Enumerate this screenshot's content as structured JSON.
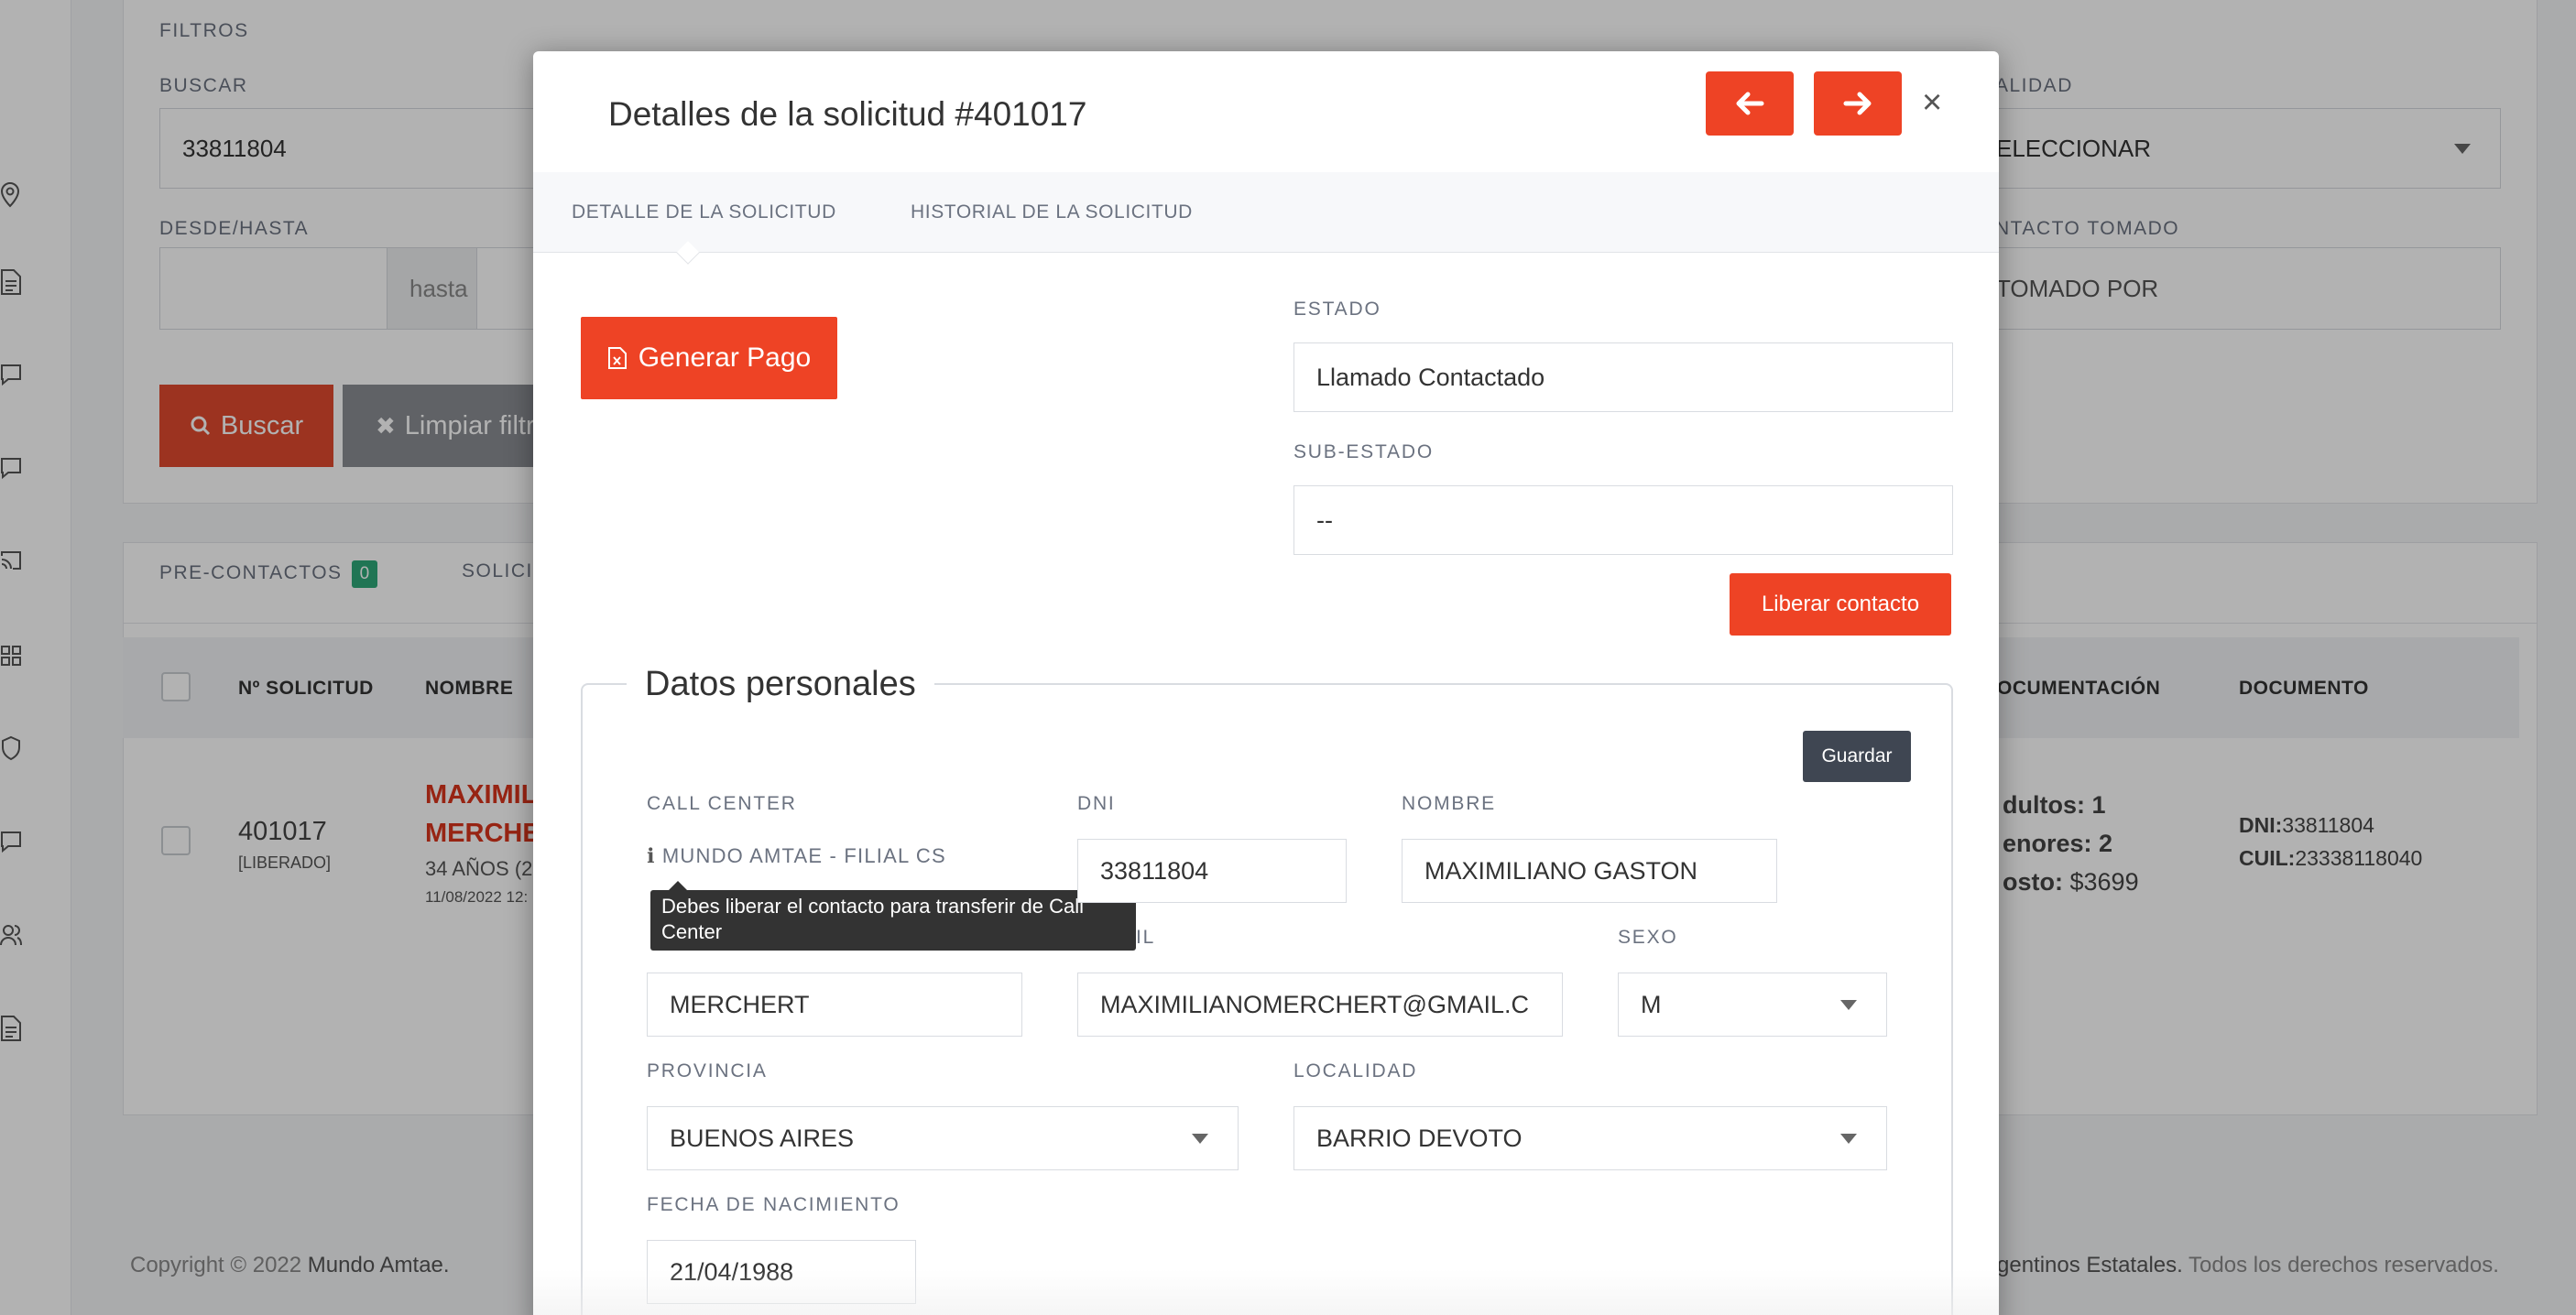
{
  "background": {
    "filters": {
      "section_title": "FILTROS",
      "buscar_label": "BUSCAR",
      "buscar_value": "33811804",
      "desde_hasta_label": "DESDE/HASTA",
      "hasta_text": "hasta",
      "localidad_label_partial": "ALIDAD",
      "localidad_value_partial": "ELECCIONAR",
      "contacto_label_partial": "NTACTO TOMADO",
      "contacto_placeholder_partial": "TOMADO POR",
      "buscar_button": "Buscar",
      "limpiar_button_partial": "Limpiar filtro"
    },
    "tabs": {
      "precontactos_label": "PRE-CONTACTOS",
      "precontactos_count": "0",
      "solicitudes_partial": "SOLICI"
    },
    "table": {
      "headers": {
        "numero": "Nº SOLICITUD",
        "nombre": "NOMBRE",
        "documentacion_partial": "OCUMENTACIÓN",
        "documento": "DOCUMENTO"
      },
      "row": {
        "numero": "401017",
        "estado": "[LIBERADO]",
        "nombre_line1_partial": "MAXIMIL",
        "nombre_line2_partial": "MERCHE",
        "edad_partial": "34 AÑOS (2",
        "fecha_partial": "11/08/2022 12:",
        "adultos_partial": "dultos: 1",
        "menores_partial": "enores: 2",
        "costo_label_partial": "osto:",
        "costo_value": "$3699",
        "dni_label": "DNI:",
        "dni_value": "33811804",
        "cuil_label": "CUIL:",
        "cuil_value": "23338118040"
      }
    },
    "footer": {
      "copyright": "Copyright © 2022",
      "brand": "Mundo Amtae.",
      "right_partial_1": "gentinos Estatales.",
      "right_partial_2": "Todos los derechos reservados."
    }
  },
  "modal": {
    "title": "Detalles de la solicitud #401017",
    "close_symbol": "×",
    "tabs": [
      "DETALLE DE LA SOLICITUD",
      "HISTORIAL DE LA SOLICITUD"
    ],
    "generar_pago_label": "Generar Pago",
    "estado_label": "ESTADO",
    "estado_value": "Llamado Contactado",
    "subestado_label": "SUB-ESTADO",
    "subestado_value": "--",
    "liberar_label": "Liberar contacto",
    "section_title": "Datos personales",
    "guardar_label": "Guardar",
    "call_center_label": "CALL CENTER",
    "call_center_value": "MUNDO AMTAE - FILIAL CS",
    "tooltip_text": "Debes liberar el contacto para transferir de Call Center",
    "dni_label": "DNI",
    "dni_value": "33811804",
    "nombre_label": "NOMBRE",
    "nombre_value": "MAXIMILIANO GASTON",
    "email_label_partial": "IL",
    "apellido_value": "MERCHERT",
    "email_value": "MAXIMILIANOMERCHERT@GMAIL.C",
    "sexo_label": "SEXO",
    "sexo_value": "M",
    "provincia_label": "PROVINCIA",
    "provincia_value": "BUENOS AIRES",
    "localidad_label": "LOCALIDAD",
    "localidad_value": "BARRIO DEVOTO",
    "fecha_label": "FECHA DE NACIMIENTO",
    "fecha_value": "21/04/1988"
  },
  "colors": {
    "accent": "#ee4325",
    "dark_button": "#3f4652",
    "badge_green": "#2ea879",
    "name_red": "#d9341c"
  }
}
